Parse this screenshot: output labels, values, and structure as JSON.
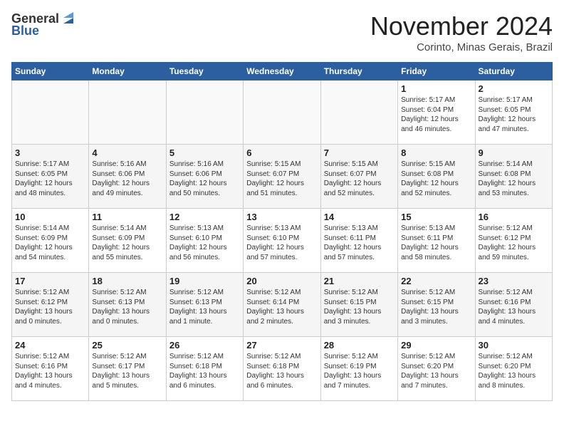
{
  "header": {
    "logo_line1": "General",
    "logo_line2": "Blue",
    "month": "November 2024",
    "location": "Corinto, Minas Gerais, Brazil"
  },
  "weekdays": [
    "Sunday",
    "Monday",
    "Tuesday",
    "Wednesday",
    "Thursday",
    "Friday",
    "Saturday"
  ],
  "weeks": [
    [
      {
        "day": "",
        "info": ""
      },
      {
        "day": "",
        "info": ""
      },
      {
        "day": "",
        "info": ""
      },
      {
        "day": "",
        "info": ""
      },
      {
        "day": "",
        "info": ""
      },
      {
        "day": "1",
        "info": "Sunrise: 5:17 AM\nSunset: 6:04 PM\nDaylight: 12 hours\nand 46 minutes."
      },
      {
        "day": "2",
        "info": "Sunrise: 5:17 AM\nSunset: 6:05 PM\nDaylight: 12 hours\nand 47 minutes."
      }
    ],
    [
      {
        "day": "3",
        "info": "Sunrise: 5:17 AM\nSunset: 6:05 PM\nDaylight: 12 hours\nand 48 minutes."
      },
      {
        "day": "4",
        "info": "Sunrise: 5:16 AM\nSunset: 6:06 PM\nDaylight: 12 hours\nand 49 minutes."
      },
      {
        "day": "5",
        "info": "Sunrise: 5:16 AM\nSunset: 6:06 PM\nDaylight: 12 hours\nand 50 minutes."
      },
      {
        "day": "6",
        "info": "Sunrise: 5:15 AM\nSunset: 6:07 PM\nDaylight: 12 hours\nand 51 minutes."
      },
      {
        "day": "7",
        "info": "Sunrise: 5:15 AM\nSunset: 6:07 PM\nDaylight: 12 hours\nand 52 minutes."
      },
      {
        "day": "8",
        "info": "Sunrise: 5:15 AM\nSunset: 6:08 PM\nDaylight: 12 hours\nand 52 minutes."
      },
      {
        "day": "9",
        "info": "Sunrise: 5:14 AM\nSunset: 6:08 PM\nDaylight: 12 hours\nand 53 minutes."
      }
    ],
    [
      {
        "day": "10",
        "info": "Sunrise: 5:14 AM\nSunset: 6:09 PM\nDaylight: 12 hours\nand 54 minutes."
      },
      {
        "day": "11",
        "info": "Sunrise: 5:14 AM\nSunset: 6:09 PM\nDaylight: 12 hours\nand 55 minutes."
      },
      {
        "day": "12",
        "info": "Sunrise: 5:13 AM\nSunset: 6:10 PM\nDaylight: 12 hours\nand 56 minutes."
      },
      {
        "day": "13",
        "info": "Sunrise: 5:13 AM\nSunset: 6:10 PM\nDaylight: 12 hours\nand 57 minutes."
      },
      {
        "day": "14",
        "info": "Sunrise: 5:13 AM\nSunset: 6:11 PM\nDaylight: 12 hours\nand 57 minutes."
      },
      {
        "day": "15",
        "info": "Sunrise: 5:13 AM\nSunset: 6:11 PM\nDaylight: 12 hours\nand 58 minutes."
      },
      {
        "day": "16",
        "info": "Sunrise: 5:12 AM\nSunset: 6:12 PM\nDaylight: 12 hours\nand 59 minutes."
      }
    ],
    [
      {
        "day": "17",
        "info": "Sunrise: 5:12 AM\nSunset: 6:12 PM\nDaylight: 13 hours\nand 0 minutes."
      },
      {
        "day": "18",
        "info": "Sunrise: 5:12 AM\nSunset: 6:13 PM\nDaylight: 13 hours\nand 0 minutes."
      },
      {
        "day": "19",
        "info": "Sunrise: 5:12 AM\nSunset: 6:13 PM\nDaylight: 13 hours\nand 1 minute."
      },
      {
        "day": "20",
        "info": "Sunrise: 5:12 AM\nSunset: 6:14 PM\nDaylight: 13 hours\nand 2 minutes."
      },
      {
        "day": "21",
        "info": "Sunrise: 5:12 AM\nSunset: 6:15 PM\nDaylight: 13 hours\nand 3 minutes."
      },
      {
        "day": "22",
        "info": "Sunrise: 5:12 AM\nSunset: 6:15 PM\nDaylight: 13 hours\nand 3 minutes."
      },
      {
        "day": "23",
        "info": "Sunrise: 5:12 AM\nSunset: 6:16 PM\nDaylight: 13 hours\nand 4 minutes."
      }
    ],
    [
      {
        "day": "24",
        "info": "Sunrise: 5:12 AM\nSunset: 6:16 PM\nDaylight: 13 hours\nand 4 minutes."
      },
      {
        "day": "25",
        "info": "Sunrise: 5:12 AM\nSunset: 6:17 PM\nDaylight: 13 hours\nand 5 minutes."
      },
      {
        "day": "26",
        "info": "Sunrise: 5:12 AM\nSunset: 6:18 PM\nDaylight: 13 hours\nand 6 minutes."
      },
      {
        "day": "27",
        "info": "Sunrise: 5:12 AM\nSunset: 6:18 PM\nDaylight: 13 hours\nand 6 minutes."
      },
      {
        "day": "28",
        "info": "Sunrise: 5:12 AM\nSunset: 6:19 PM\nDaylight: 13 hours\nand 7 minutes."
      },
      {
        "day": "29",
        "info": "Sunrise: 5:12 AM\nSunset: 6:20 PM\nDaylight: 13 hours\nand 7 minutes."
      },
      {
        "day": "30",
        "info": "Sunrise: 5:12 AM\nSunset: 6:20 PM\nDaylight: 13 hours\nand 8 minutes."
      }
    ]
  ]
}
